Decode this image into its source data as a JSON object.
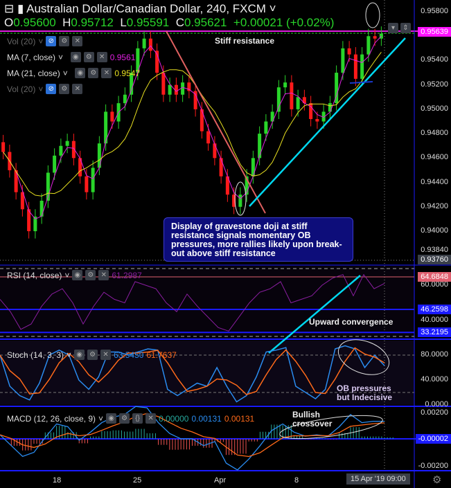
{
  "header": {
    "title": "Australian Dollar/Canadian Dollar, 240, FXCM",
    "ohlc": {
      "o_label": "O",
      "o": "0.95600",
      "h_label": "H",
      "h": "0.95712",
      "l_label": "L",
      "l": "0.95591",
      "c_label": "C",
      "c": "0.95621",
      "change": "+0.00021 (+0.02%)"
    }
  },
  "legends": {
    "vol1": "Vol (20)",
    "ma7": "MA (7, close)",
    "ma7_value": "0.9561",
    "ma21": "MA (21, close)",
    "ma21_value": "0.9547",
    "vol2": "Vol (20)",
    "rsi": "RSI (14, close)",
    "rsi_value": "61.2987",
    "stoch": "Stoch (14, 3, 3)",
    "stoch_k": "63.5450",
    "stoch_d": "61.7637",
    "macd": "MACD (12, 26, close, 9)",
    "macd_hist": "0.00000",
    "macd_line": "0.00131",
    "macd_signal": "0.00131"
  },
  "price_axis": {
    "ticks": [
      "0.95800",
      "0.95400",
      "0.95200",
      "0.95000",
      "0.94800",
      "0.94600",
      "0.94400",
      "0.94200",
      "0.94000",
      "0.93840"
    ],
    "current": "0.95639",
    "crosshair": "0.93760"
  },
  "rsi_axis": {
    "ticks": [
      "60.0000",
      "40.0000"
    ],
    "tags": [
      "64.6848",
      "46.2598",
      "33.2195"
    ]
  },
  "stoch_axis": {
    "ticks": [
      "80.0000",
      "40.0000",
      "0.0000"
    ]
  },
  "macd_axis": {
    "ticks": [
      "0.00200",
      "-0.00200"
    ],
    "tag": "-0.00002"
  },
  "time_axis": {
    "ticks": [
      "18",
      "25",
      "Apr",
      "8"
    ],
    "cursor": "15 Apr '19   09:00"
  },
  "annotations": {
    "resistance": "Stiff resistance",
    "box": "Display of gravestone doji at stiff resistance signals momentary OB pressures, more rallies likely upon break-out above stiff resistance",
    "rsi": "Upward convergence",
    "stoch": "OB pressures but Indecisive",
    "macd": "Bullish crossover"
  },
  "colors": {
    "up": "#29d52a",
    "down": "#ff1a1a",
    "ma7": "#e020e0",
    "ma21": "#e8e020",
    "rsi": "#8a1ea0",
    "stoch_k": "#2a8cf0",
    "stoch_d": "#ff6a1a",
    "accent": "#00d8f0",
    "resistance": "#e020e0"
  },
  "chart_data": {
    "type": "candlestick",
    "symbol": "AUDCAD",
    "interval": "240",
    "price_closes": [
      0.9465,
      0.945,
      0.9432,
      0.9418,
      0.94,
      0.9412,
      0.9425,
      0.9448,
      0.9462,
      0.947,
      0.9474,
      0.946,
      0.9445,
      0.9432,
      0.9452,
      0.9472,
      0.9498,
      0.949,
      0.9505,
      0.9512,
      0.953,
      0.955,
      0.9558,
      0.9548,
      0.953,
      0.9512,
      0.952,
      0.9512,
      0.9522,
      0.9515,
      0.95,
      0.9482,
      0.9472,
      0.946,
      0.9445,
      0.943,
      0.942,
      0.943,
      0.9445,
      0.946,
      0.948,
      0.949,
      0.9498,
      0.9518,
      0.9522,
      0.95,
      0.951,
      0.9505,
      0.9492,
      0.949,
      0.9498,
      0.9505,
      0.953,
      0.955,
      0.9545,
      0.9525,
      0.9545,
      0.956,
      0.9558,
      0.9562
    ],
    "price_range": [
      0.9376,
      0.9582
    ],
    "rsi": [
      52,
      45,
      35,
      38,
      48,
      55,
      58,
      50,
      38,
      48,
      56,
      52,
      50,
      62,
      60,
      58,
      50,
      45,
      55,
      48,
      42,
      36,
      34,
      42,
      50,
      56,
      58,
      62,
      50,
      52,
      54,
      60,
      64,
      66,
      54,
      66,
      58,
      61
    ],
    "rsi_levels": [
      64.6848,
      46.2598,
      33.2195
    ],
    "stoch_k": [
      80,
      30,
      15,
      8,
      35,
      80,
      88,
      80,
      40,
      25,
      45,
      85,
      85,
      80,
      85,
      90,
      88,
      25,
      15,
      25,
      35,
      30,
      60,
      30,
      5,
      15,
      45,
      85,
      88,
      92,
      30,
      20,
      10,
      25,
      90,
      95,
      90,
      60,
      80,
      63
    ],
    "macd": [
      0.0003,
      -0.0005,
      -0.0013,
      -0.001,
      0.0001,
      0.0011,
      0.0009,
      -0.0001,
      0.0005,
      0.0012,
      0.0016,
      0.0018,
      0.0024,
      0.0023,
      0.0012,
      0.0004,
      0,
      0,
      -0.0005,
      -0.0002,
      -0.0018,
      -0.0023,
      -0.0015,
      -0.0005,
      0.0006,
      0.0011,
      0.0005,
      0.0002,
      0.0003,
      0.0002,
      0.0009,
      0.0018,
      0.0012,
      0.0013,
      0.0013
    ]
  }
}
